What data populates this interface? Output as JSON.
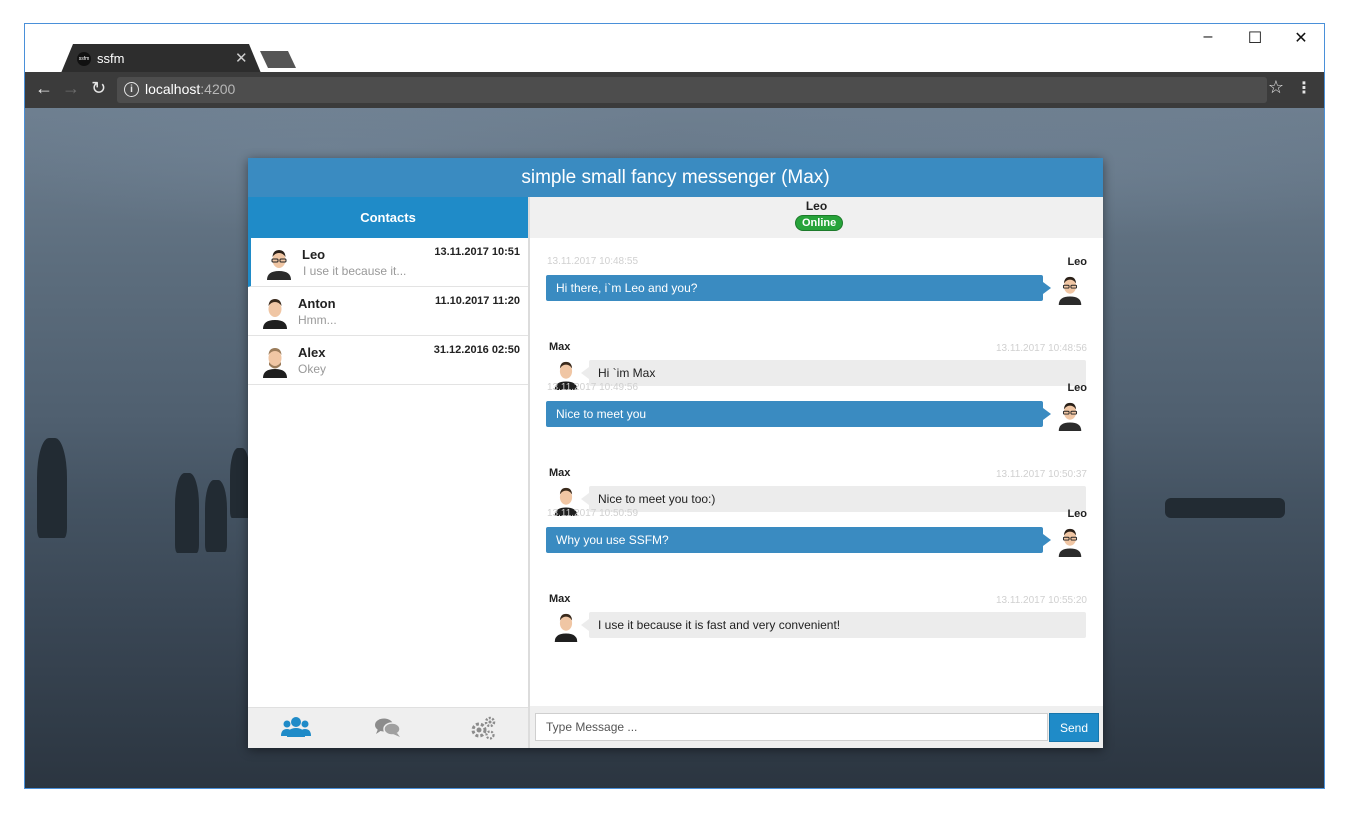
{
  "browser": {
    "tab_favicon": "ssfm",
    "tab_title": "ssfm",
    "url_host": "localhost",
    "url_port": ":4200"
  },
  "app": {
    "title": "simple small fancy messenger (Max)",
    "contacts_header": "Contacts",
    "contacts": [
      {
        "name": "Leo",
        "preview": "I use it because it...",
        "time": "13.11.2017 10:51",
        "active": true
      },
      {
        "name": "Anton",
        "preview": "Hmm...",
        "time": "11.10.2017 11:20",
        "active": false
      },
      {
        "name": "Alex",
        "preview": "Okey",
        "time": "31.12.2016 02:50",
        "active": false
      }
    ],
    "footer_icons": [
      "users-icon",
      "chat-bubbles-icon",
      "settings-gears-icon"
    ],
    "chat": {
      "partner_name": "Leo",
      "partner_status": "Online",
      "messages": [
        {
          "direction": "out",
          "sender": "Leo",
          "time": "13.11.2017 10:48:55",
          "text": "Hi there, i`m Leo and you?"
        },
        {
          "direction": "in",
          "sender": "Max",
          "time": "13.11.2017 10:48:56",
          "text": "Hi `im Max"
        },
        {
          "direction": "out",
          "sender": "Leo",
          "time": "13.11.2017 10:49:56",
          "text": "Nice to meet you"
        },
        {
          "direction": "in",
          "sender": "Max",
          "time": "13.11.2017 10:50:37",
          "text": "Nice to meet you too:)"
        },
        {
          "direction": "out",
          "sender": "Leo",
          "time": "13.11.2017 10:50:59",
          "text": "Why you use SSFM?"
        },
        {
          "direction": "in",
          "sender": "Max",
          "time": "13.11.2017 10:55:20",
          "text": "I use it because it is fast and very convenient!"
        }
      ],
      "input_placeholder": "Type Message ...",
      "input_value": "",
      "send_label": "Send"
    },
    "colors": {
      "header_blue": "#3a8bc1",
      "accent_blue": "#1f8bc8",
      "online_green": "#27a33a"
    }
  }
}
